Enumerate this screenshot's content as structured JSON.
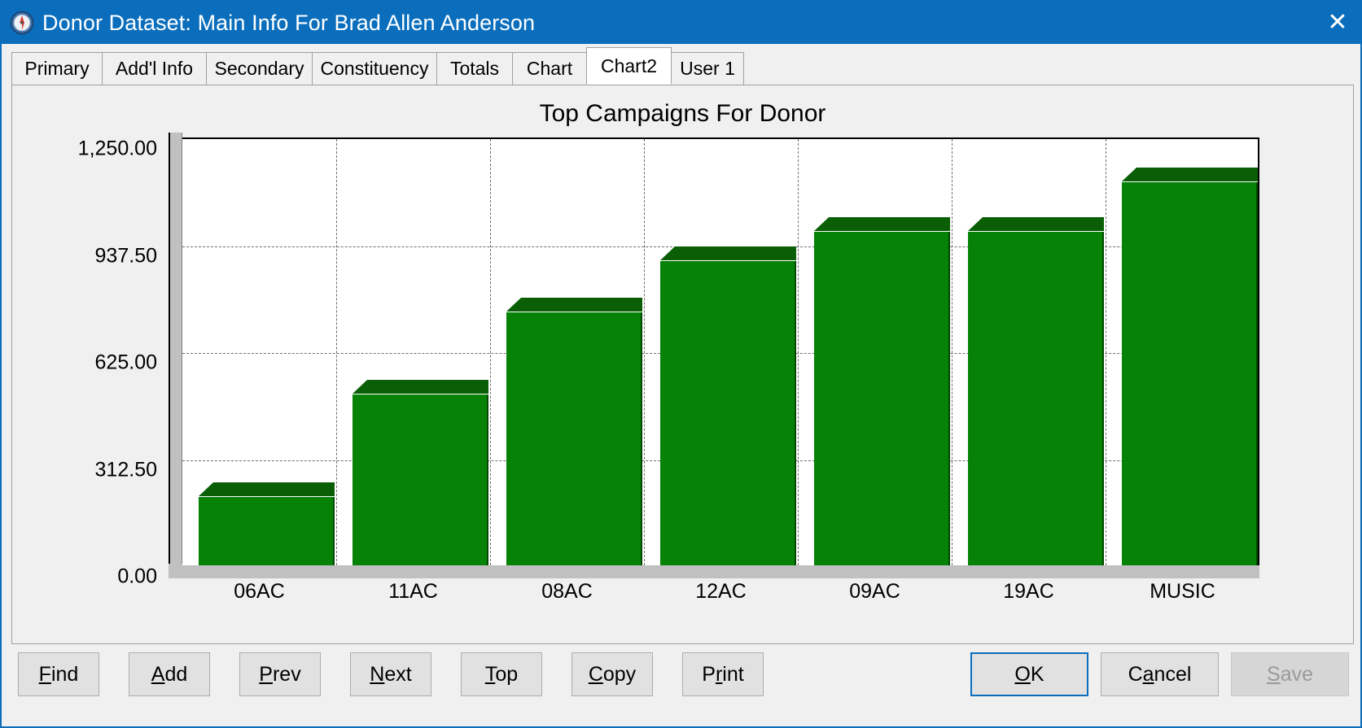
{
  "window": {
    "title": "Donor Dataset: Main Info For Brad Allen Anderson",
    "icon": "compass-icon",
    "close_label": "✕",
    "accent_color": "#0a6ebd"
  },
  "tabs": [
    {
      "label": "Primary",
      "active": false
    },
    {
      "label": "Add'l Info",
      "active": false
    },
    {
      "label": "Secondary",
      "active": false
    },
    {
      "label": "Constituency",
      "active": false
    },
    {
      "label": "Totals",
      "active": false
    },
    {
      "label": "Chart",
      "active": false
    },
    {
      "label": "Chart2",
      "active": true
    },
    {
      "label": "User 1",
      "active": false
    }
  ],
  "chart_data": {
    "type": "bar",
    "title": "Top Campaigns For Donor",
    "xlabel": "",
    "ylabel": "",
    "categories": [
      "06AC",
      "11AC",
      "08AC",
      "12AC",
      "09AC",
      "19AC",
      "MUSIC"
    ],
    "values": [
      200.0,
      500.0,
      740.0,
      890.0,
      975.0,
      975.0,
      1120.0
    ],
    "ylim": [
      0,
      1250
    ],
    "ytick_values": [
      0,
      312.5,
      625,
      937.5,
      1250
    ],
    "ytick_labels": [
      "0.00",
      "312.50",
      "625.00",
      "937.50",
      "1,250.00"
    ],
    "grid": true,
    "legend": false,
    "bar_color": "#068206",
    "bar_top_color": "#0a5f06",
    "bar_side_color": "#024802",
    "plot_background": "#ffffff",
    "wall_color": "#c0c0c0",
    "gridline_color": "#6e6e6e",
    "style": "3d-bar"
  },
  "buttons": {
    "left": [
      {
        "label": "Find",
        "mnemonic": "F",
        "state": "normal"
      },
      {
        "label": "Add",
        "mnemonic": "A",
        "state": "normal"
      },
      {
        "label": "Prev",
        "mnemonic": "P",
        "state": "normal"
      },
      {
        "label": "Next",
        "mnemonic": "N",
        "state": "normal"
      },
      {
        "label": "Top",
        "mnemonic": "T",
        "state": "normal"
      },
      {
        "label": "Copy",
        "mnemonic": "C",
        "state": "normal"
      },
      {
        "label": "Print",
        "mnemonic": "r",
        "state": "normal"
      }
    ],
    "right": [
      {
        "label": "OK",
        "mnemonic": "O",
        "state": "focused"
      },
      {
        "label": "Cancel",
        "mnemonic": "a",
        "state": "normal"
      },
      {
        "label": "Save",
        "mnemonic": "S",
        "state": "disabled"
      }
    ]
  }
}
